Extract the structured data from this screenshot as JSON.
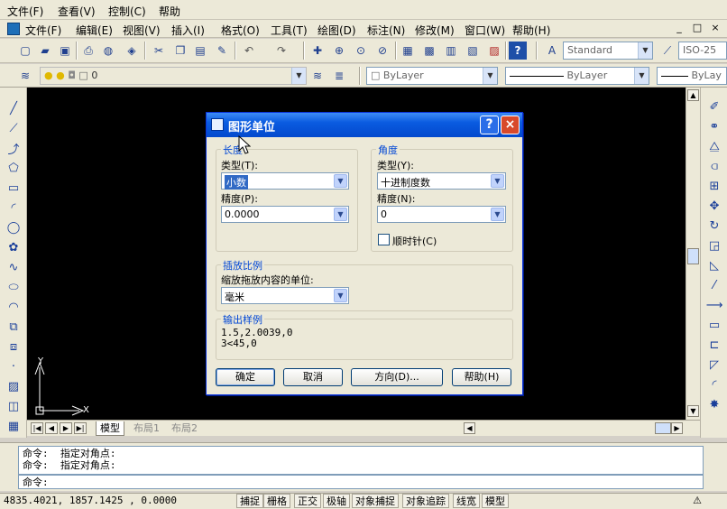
{
  "outer_menu": [
    "文件(F)",
    "查看(V)",
    "控制(C)",
    "帮助"
  ],
  "app_menu": [
    "文件(F)",
    "编辑(E)",
    "视图(V)",
    "插入(I)",
    "格式(O)",
    "工具(T)",
    "绘图(D)",
    "标注(N)",
    "修改(M)",
    "窗口(W)",
    "帮助(H)"
  ],
  "window_controls": [
    "_",
    "□",
    "×"
  ],
  "toolbar": {
    "text_style": "Standard",
    "dim_style": "ISO-25",
    "layer": "0",
    "color": "ByLayer",
    "linetype": "ByLayer",
    "lineweight": "ByLay"
  },
  "axes": {
    "x": "X",
    "y": "Y"
  },
  "tabs": {
    "model": "模型",
    "layout1": "布局1",
    "layout2": "布局2"
  },
  "command": {
    "history": [
      "命令:  指定对角点:",
      "命令:  指定对角点:"
    ],
    "prompt": "命令:"
  },
  "status": {
    "coords": "4835.4021,  1857.1425 , 0.0000",
    "buttons": [
      "捕捉",
      "栅格",
      "正交",
      "极轴",
      "对象捕捉",
      "对象追踪",
      "线宽",
      "模型"
    ]
  },
  "dialog": {
    "title": "图形单位",
    "help_btn": "?",
    "close_btn": "×",
    "length": {
      "group": "长度",
      "type_label": "类型(T):",
      "type_value": "小数",
      "precision_label": "精度(P):",
      "precision_value": "0.0000"
    },
    "angle": {
      "group": "角度",
      "type_label": "类型(Y):",
      "type_value": "十进制度数",
      "precision_label": "精度(N):",
      "precision_value": "0",
      "clockwise_label": "顺时针(C)",
      "clockwise_checked": false
    },
    "insert_scale": {
      "group": "插放比例",
      "label": "缩放拖放内容的单位:",
      "value": "毫米"
    },
    "sample": {
      "group": "输出样例",
      "line1": "1.5,2.0039,0",
      "line2": "3<45,0"
    },
    "buttons": {
      "ok": "确定",
      "cancel": "取消",
      "direction": "方向(D)...",
      "help": "帮助(H)"
    }
  }
}
